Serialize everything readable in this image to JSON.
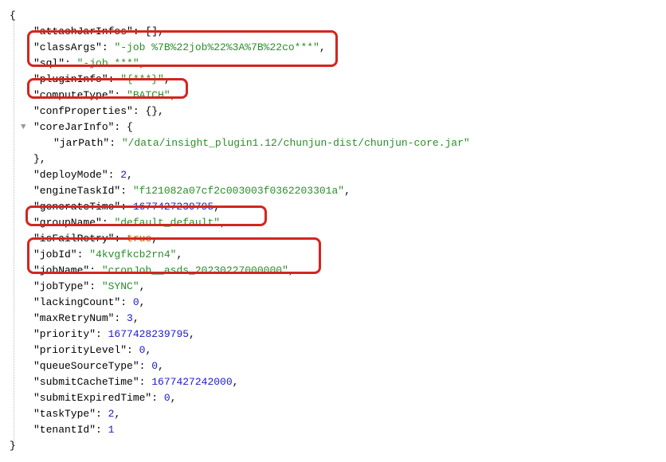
{
  "lines": {
    "open_brace": "{",
    "attachJarInfos_k": "\"attachJarInfos\"",
    "attachJarInfos_v": "[]",
    "classArgs_k": "\"classArgs\"",
    "classArgs_v": "\"-job %7B%22job%22%3A%7B%22co***\"",
    "sql_k": "\"sql\"",
    "sql_v": "\"-job ***\"",
    "pluginInfo_k": "\"pluginInfo\"",
    "pluginInfo_v": "\"{***}\"",
    "computeType_k": "\"computeType\"",
    "computeType_v": "\"BATCH\"",
    "confProperties_k": "\"confProperties\"",
    "confProperties_v": "{}",
    "coreJarInfo_k": "\"coreJarInfo\"",
    "coreJarInfo_open": "{",
    "jarPath_k": "\"jarPath\"",
    "jarPath_v": "\"/data/insight_plugin1.12/chunjun-dist/chunjun-core.jar\"",
    "coreJarInfo_close": "}",
    "deployMode_k": "\"deployMode\"",
    "deployMode_v": "2",
    "engineTaskId_k": "\"engineTaskId\"",
    "engineTaskId_v": "\"f121082a07cf2c003003f0362203301a\"",
    "generateTime_k": "\"generateTime\"",
    "generateTime_v": "1677427239795",
    "groupName_k": "\"groupName\"",
    "groupName_v": "\"default_default\"",
    "isFailRetry_k": "\"isFailRetry\"",
    "isFailRetry_v": "true",
    "jobId_k": "\"jobId\"",
    "jobId_v": "\"4kvgfkcb2rn4\"",
    "jobName_k": "\"jobName\"",
    "jobName_v": "\"cronJob__asds_20230227000000\"",
    "jobType_k": "\"jobType\"",
    "jobType_v": "\"SYNC\"",
    "lackingCount_k": "\"lackingCount\"",
    "lackingCount_v": "0",
    "maxRetryNum_k": "\"maxRetryNum\"",
    "maxRetryNum_v": "3",
    "priority_k": "\"priority\"",
    "priority_v": "1677428239795",
    "priorityLevel_k": "\"priorityLevel\"",
    "priorityLevel_v": "0",
    "queueSourceType_k": "\"queueSourceType\"",
    "queueSourceType_v": "0",
    "submitCacheTime_k": "\"submitCacheTime\"",
    "submitCacheTime_v": "1677427242000",
    "submitExpiredTime_k": "\"submitExpiredTime\"",
    "submitExpiredTime_v": "0",
    "taskType_k": "\"taskType\"",
    "taskType_v": "2",
    "tenantId_k": "\"tenantId\"",
    "tenantId_v": "1",
    "close_brace": "}"
  },
  "highlights": {
    "box1": [
      "classArgs",
      "sql"
    ],
    "box2": [
      "pluginInfo"
    ],
    "box3": [
      "groupName"
    ],
    "box4": [
      "jobId",
      "jobName"
    ]
  }
}
